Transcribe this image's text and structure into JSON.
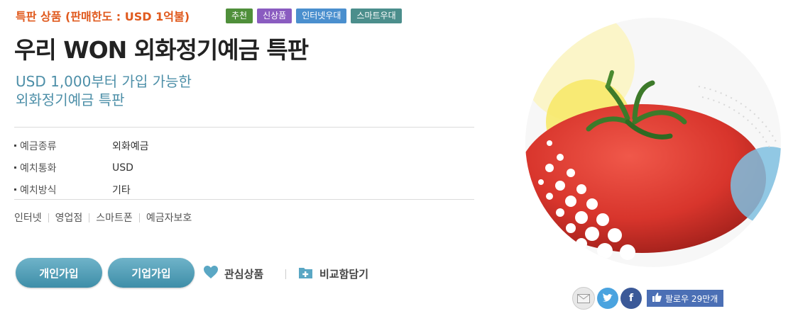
{
  "header": {
    "special_label": "특판 상품 (판매한도 : USD 1억불)",
    "badges": [
      {
        "label": "추천",
        "color": "#4f8f3a"
      },
      {
        "label": "신상품",
        "color": "#8a5cc0"
      },
      {
        "label": "인터넷우대",
        "color": "#4a8fce"
      },
      {
        "label": "스마트우대",
        "color": "#4b8e8c"
      }
    ]
  },
  "product": {
    "title": "우리 WON 외화정기예금 특판",
    "subtitle_line1": "USD 1,000부터 가입 가능한",
    "subtitle_line2": "외화정기예금 특판"
  },
  "info": [
    {
      "key": "예금종류",
      "value": "외화예금"
    },
    {
      "key": "예치통화",
      "value": "USD"
    },
    {
      "key": "예치방식",
      "value": "기타"
    }
  ],
  "channels": [
    "인터넷",
    "영업점",
    "스마트폰",
    "예금자보호"
  ],
  "actions": {
    "personal_join": "개인가입",
    "corporate_join": "기업가입",
    "favorite": "관심상품",
    "compare": "비교함담기"
  },
  "social": {
    "follow_label": "팔로우 29만개"
  },
  "colors": {
    "accent": "#e05a1e",
    "subtitle": "#4d8fa8",
    "button": "#4a9ab4"
  }
}
